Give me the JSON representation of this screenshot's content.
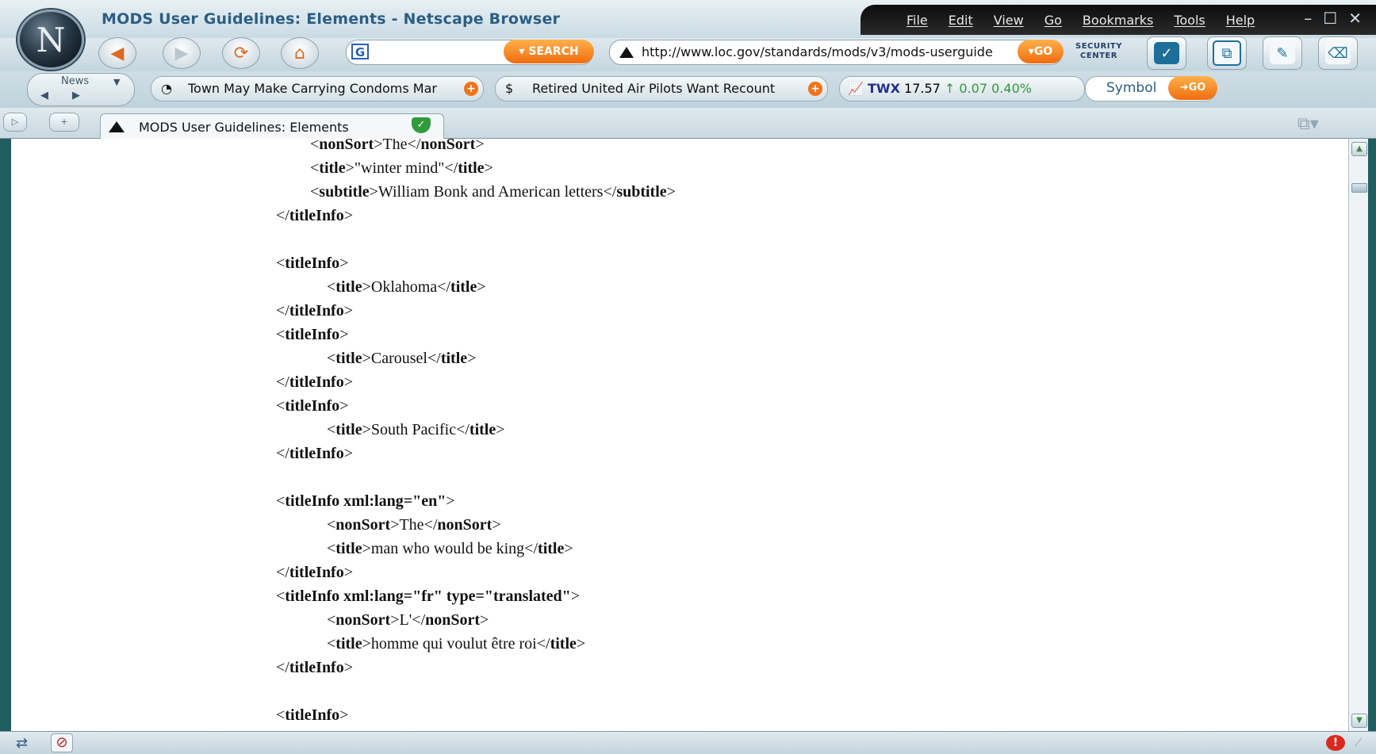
{
  "window": {
    "title": "MODS User Guidelines: Elements - Netscape Browser",
    "menu": [
      "File",
      "Edit",
      "View",
      "Go",
      "Bookmarks",
      "Tools",
      "Help"
    ],
    "controls": [
      "–",
      "☐",
      "✕"
    ]
  },
  "toolbar": {
    "search_button": "SEARCH",
    "search_value": "",
    "url": "http://www.loc.gov/standards/mods/v3/mods-userguide",
    "go_button": "GO",
    "security_label_1": "SECURITY",
    "security_label_2": "CENTER"
  },
  "news": {
    "label": "News",
    "headline_1": "Town May Make Carrying Condoms Mar",
    "headline_2": "Retired United Air Pilots Want Recount",
    "stock_symbol": "TWX",
    "stock_price": "17.57",
    "stock_change": "↑ 0.07 0.40%",
    "symbol_placeholder": "Symbol",
    "symbol_go": "GO"
  },
  "tab": {
    "title": "MODS User Guidelines: Elements"
  },
  "content_lines": [
    {
      "indent": "inner2",
      "parts": [
        [
          "t",
          "<"
        ],
        [
          "b",
          "nonSort"
        ],
        [
          "t",
          ">The</"
        ],
        [
          "b",
          "nonSort"
        ],
        [
          "t",
          ">"
        ]
      ]
    },
    {
      "indent": "inner2",
      "parts": [
        [
          "t",
          "<"
        ],
        [
          "b",
          "title"
        ],
        [
          "t",
          ">\"winter mind\"</"
        ],
        [
          "b",
          "title"
        ],
        [
          "t",
          ">"
        ]
      ]
    },
    {
      "indent": "inner2",
      "parts": [
        [
          "t",
          "<"
        ],
        [
          "b",
          "subtitle"
        ],
        [
          "t",
          ">William Bonk and American letters</"
        ],
        [
          "b",
          "subtitle"
        ],
        [
          "t",
          ">"
        ]
      ]
    },
    {
      "indent": "outer",
      "parts": [
        [
          "t",
          "</"
        ],
        [
          "b",
          "titleInfo"
        ],
        [
          "t",
          ">"
        ]
      ]
    },
    {
      "indent": "blank",
      "parts": []
    },
    {
      "indent": "outer",
      "parts": [
        [
          "t",
          "<"
        ],
        [
          "b",
          "titleInfo"
        ],
        [
          "t",
          ">"
        ]
      ]
    },
    {
      "indent": "inner",
      "parts": [
        [
          "t",
          "<"
        ],
        [
          "b",
          "title"
        ],
        [
          "t",
          ">Oklahoma</"
        ],
        [
          "b",
          "title"
        ],
        [
          "t",
          ">"
        ]
      ]
    },
    {
      "indent": "outer",
      "parts": [
        [
          "t",
          "</"
        ],
        [
          "b",
          "titleInfo"
        ],
        [
          "t",
          ">"
        ]
      ]
    },
    {
      "indent": "outer",
      "parts": [
        [
          "t",
          "<"
        ],
        [
          "b",
          "titleInfo"
        ],
        [
          "t",
          ">"
        ]
      ]
    },
    {
      "indent": "inner",
      "parts": [
        [
          "t",
          "<"
        ],
        [
          "b",
          "title"
        ],
        [
          "t",
          ">Carousel</"
        ],
        [
          "b",
          "title"
        ],
        [
          "t",
          ">"
        ]
      ]
    },
    {
      "indent": "outer",
      "parts": [
        [
          "t",
          "</"
        ],
        [
          "b",
          "titleInfo"
        ],
        [
          "t",
          ">"
        ]
      ]
    },
    {
      "indent": "outer",
      "parts": [
        [
          "t",
          "<"
        ],
        [
          "b",
          "titleInfo"
        ],
        [
          "t",
          ">"
        ]
      ]
    },
    {
      "indent": "inner",
      "parts": [
        [
          "t",
          "<"
        ],
        [
          "b",
          "title"
        ],
        [
          "t",
          ">South Pacific</"
        ],
        [
          "b",
          "title"
        ],
        [
          "t",
          ">"
        ]
      ]
    },
    {
      "indent": "outer",
      "parts": [
        [
          "t",
          "</"
        ],
        [
          "b",
          "titleInfo"
        ],
        [
          "t",
          ">"
        ]
      ]
    },
    {
      "indent": "blank",
      "parts": []
    },
    {
      "indent": "outer",
      "parts": [
        [
          "t",
          "<"
        ],
        [
          "b",
          "titleInfo xml:lang=\"en\""
        ],
        [
          "t",
          ">"
        ]
      ]
    },
    {
      "indent": "inner",
      "parts": [
        [
          "t",
          "<"
        ],
        [
          "b",
          "nonSort"
        ],
        [
          "t",
          ">The</"
        ],
        [
          "b",
          "nonSort"
        ],
        [
          "t",
          ">"
        ]
      ]
    },
    {
      "indent": "inner",
      "parts": [
        [
          "t",
          "<"
        ],
        [
          "b",
          "title"
        ],
        [
          "t",
          ">man who would be king</"
        ],
        [
          "b",
          "title"
        ],
        [
          "t",
          ">"
        ]
      ]
    },
    {
      "indent": "outer",
      "parts": [
        [
          "t",
          "</"
        ],
        [
          "b",
          "titleInfo"
        ],
        [
          "t",
          ">"
        ]
      ]
    },
    {
      "indent": "outer",
      "parts": [
        [
          "t",
          "<"
        ],
        [
          "b",
          "titleInfo xml:lang=\"fr\" type=\"translated\""
        ],
        [
          "t",
          ">"
        ]
      ]
    },
    {
      "indent": "inner",
      "parts": [
        [
          "t",
          "<"
        ],
        [
          "b",
          "nonSort"
        ],
        [
          "t",
          ">L'</"
        ],
        [
          "b",
          "nonSort"
        ],
        [
          "t",
          ">"
        ]
      ]
    },
    {
      "indent": "inner",
      "parts": [
        [
          "t",
          "<"
        ],
        [
          "b",
          "title"
        ],
        [
          "t",
          ">homme qui voulut être roi</"
        ],
        [
          "b",
          "title"
        ],
        [
          "t",
          ">"
        ]
      ]
    },
    {
      "indent": "outer",
      "parts": [
        [
          "t",
          "</"
        ],
        [
          "b",
          "titleInfo"
        ],
        [
          "t",
          ">"
        ]
      ]
    },
    {
      "indent": "blank",
      "parts": []
    },
    {
      "indent": "outer",
      "parts": [
        [
          "t",
          "<"
        ],
        [
          "b",
          "titleInfo"
        ],
        [
          "t",
          ">"
        ]
      ]
    }
  ],
  "colors": {
    "accent_orange": "#ef6d10",
    "title_blue": "#2c5e84",
    "stock_up_green": "#2e9a3a"
  }
}
